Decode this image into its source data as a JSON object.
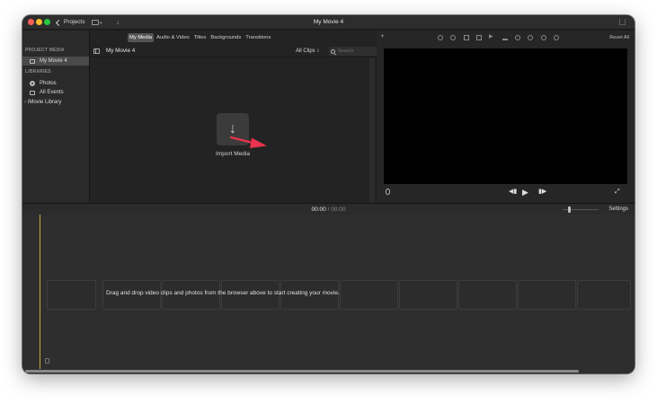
{
  "window": {
    "title": "My Movie 4",
    "projects_label": "Projects"
  },
  "sidebar": {
    "project_media_header": "PROJECT MEDIA",
    "project_item": "My Movie 4",
    "libraries_header": "LIBRARIES",
    "library_items": [
      "Photos",
      "All Events",
      "iMovie Library"
    ]
  },
  "browser": {
    "tabs": [
      "My Media",
      "Audio & Video",
      "Titles",
      "Backgrounds",
      "Transitions"
    ],
    "active_tab": "My Media",
    "title": "My Movie 4",
    "clips_filter": "All Clips ↕",
    "search_placeholder": "Search",
    "import_label": "Import Media"
  },
  "viewer": {
    "reset_all": "Reset All"
  },
  "timeline": {
    "timecode_current": "00:00",
    "timecode_separator": "/",
    "timecode_total": "00:00",
    "settings_label": "Settings",
    "hint": "Drag and drop video clips and photos from the browser above to start creating your movie."
  },
  "icons": {
    "import_arrow": "arrow-down-icon",
    "play": "play-icon",
    "skip_back": "skip-back-icon",
    "skip_forward": "skip-forward-icon",
    "fullscreen": "fullscreen-icon",
    "microphone": "microphone-icon"
  },
  "colors": {
    "annotation_arrow": "#e8344e",
    "playhead": "#c8a93a",
    "close": "#fe5f57",
    "minimize": "#febc2e",
    "maximize": "#28c840"
  }
}
